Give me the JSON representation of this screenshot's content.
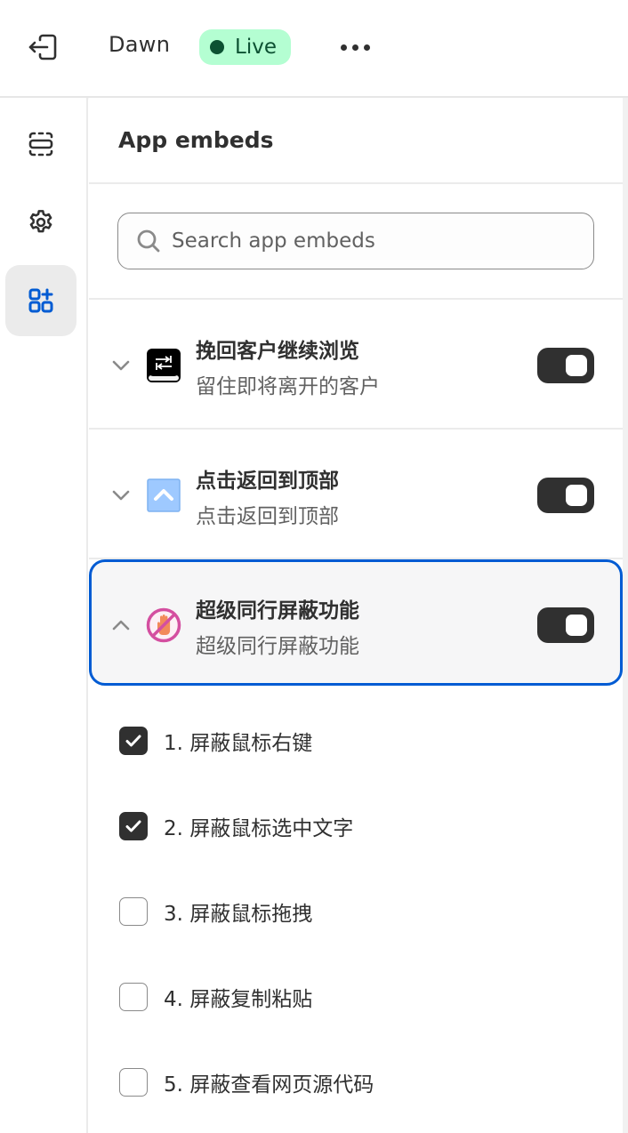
{
  "topbar": {
    "exit_icon": "exit-icon",
    "theme_name": "Dawn",
    "status_badge": {
      "label": "Live",
      "bg": "#b4fed2",
      "dot_color": "#0c5132",
      "text_color": "#0c5132"
    },
    "more_icon": "ellipsis-icon"
  },
  "rail": {
    "items": [
      {
        "name": "sections",
        "icon": "sections-icon",
        "active": false
      },
      {
        "name": "theme-settings",
        "icon": "gear-icon",
        "active": false
      },
      {
        "name": "app-embeds",
        "icon": "apps-add-icon",
        "active": true
      }
    ],
    "active_color": "#005bd3"
  },
  "panel": {
    "title": "App embeds",
    "search": {
      "placeholder": "Search app embeds",
      "value": ""
    },
    "embeds": [
      {
        "title": "挽回客户继续浏览",
        "subtitle": "留住即将离开的客户",
        "icon": "keyboard-tab-icon",
        "enabled": true,
        "expanded": false
      },
      {
        "title": "点击返回到顶部",
        "subtitle": "点击返回到顶部",
        "icon": "back-to-top-icon",
        "enabled": true,
        "expanded": false
      },
      {
        "title": "超级同行屏蔽功能",
        "subtitle": "超级同行屏蔽功能",
        "icon": "no-hand-icon",
        "enabled": true,
        "expanded": true
      }
    ],
    "options": [
      {
        "label": "1. 屏蔽鼠标右键",
        "checked": true
      },
      {
        "label": "2. 屏蔽鼠标选中文字",
        "checked": true
      },
      {
        "label": "3. 屏蔽鼠标拖拽",
        "checked": false
      },
      {
        "label": "4. 屏蔽复制粘贴",
        "checked": false
      },
      {
        "label": "5. 屏蔽查看网页源代码",
        "checked": false
      }
    ],
    "focus_color": "#005bd3"
  }
}
